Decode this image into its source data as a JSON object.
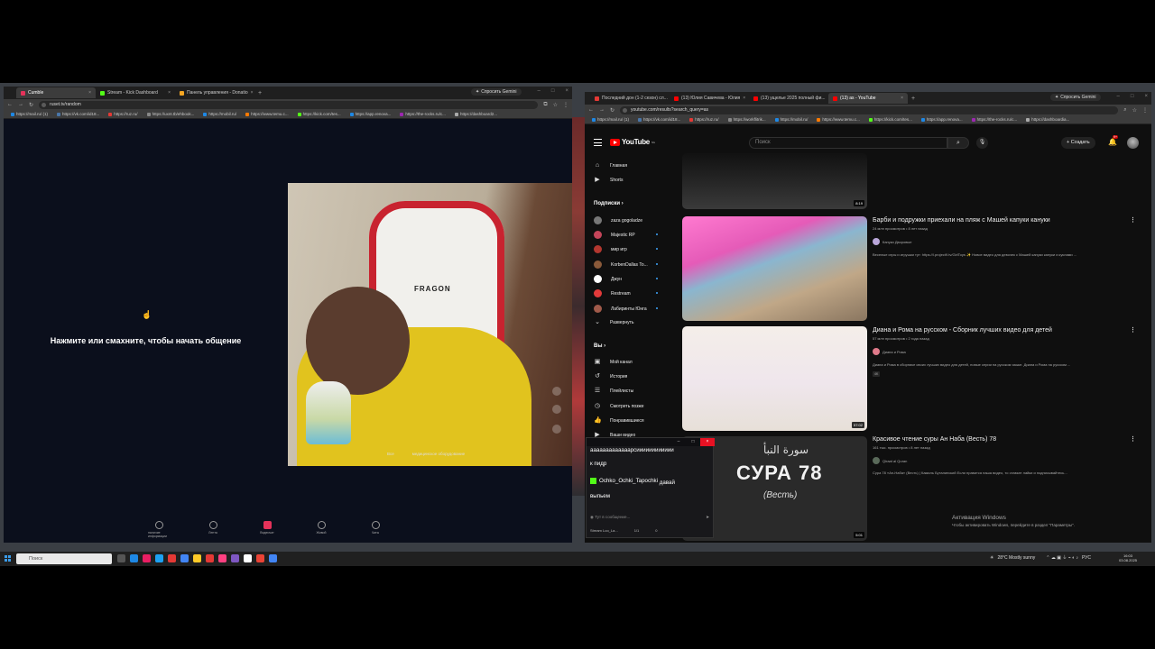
{
  "left_browser": {
    "tabs": [
      {
        "title": "Cumble",
        "color": "#e5325a",
        "active": true
      },
      {
        "title": "Stream - Kick Dashboard",
        "color": "#53fc18",
        "active": false
      },
      {
        "title": "Панель управления - Donatio",
        "color": "#f5a623",
        "active": false
      }
    ],
    "gemini_label": "Спросить Gemini",
    "url": "ruset.tv/random",
    "bookmarks": [
      "https://mail.ru/ (1)",
      "https://vk.com/id18...",
      "https://ruz.ru/",
      "https://uxnt.tb/ehbook...",
      "https://mobil.ru/",
      "https://www.temu.c...",
      "https://kick.com/tes...",
      "https://app.renova...",
      "https://the-rocks.ru/c...",
      "https://dashboard2..."
    ]
  },
  "left_app": {
    "prompt_text": "Нажмите или смахните, чтобы начать общение",
    "cam_label": "FRAGON",
    "overlay_left": "Все",
    "overlay_right": "медицинское оборудование",
    "nav": [
      {
        "label": "наличие информации",
        "active": false
      },
      {
        "label": "Лента",
        "active": false
      },
      {
        "label": "Видеочат",
        "active": true
      },
      {
        "label": "Живой",
        "active": false
      },
      {
        "label": "Чаты",
        "active": false
      }
    ]
  },
  "right_browser": {
    "tabs": [
      {
        "title": "Последний дон (1-2 сезон) сл...",
        "color": "#e53935",
        "active": false
      },
      {
        "title": "(13) Юлия Савичева - Юлия",
        "color": "#ff0000",
        "active": false
      },
      {
        "title": "(13) ущелье 2025 полный фи...",
        "color": "#ff0000",
        "active": false
      },
      {
        "title": "(13) as - YouTube",
        "color": "#ff0000",
        "active": true
      }
    ],
    "gemini_label": "Спросить Gemini",
    "url": "youtube.com/results?search_query=as",
    "bookmarks": [
      "https://mail.ru/ (1)",
      "https://vk.com/id18...",
      "https://ruz.ru/",
      "https://workflitrik...",
      "https://mobil.ru/",
      "https://www.temu.c...",
      "https://kick.com/tes...",
      "https://app.renova...",
      "https://the-rocks.ru/c...",
      "https://dashboardia..."
    ]
  },
  "youtube": {
    "logo": "YouTube",
    "logo_region": "NG",
    "search_placeholder": "Поиск",
    "create_label": "Создать",
    "notif_count": "9+",
    "sidebar": {
      "main": [
        "Главная",
        "Shorts"
      ],
      "subs_header": "Подписки",
      "subs": [
        {
          "name": "zaza gogoladze",
          "color": "#777777",
          "dot": false
        },
        {
          "name": "Majestic RP",
          "color": "#c4455a",
          "dot": true
        },
        {
          "name": "мир игр",
          "color": "#b3372f",
          "dot": true
        },
        {
          "name": "KorbenDallas To...",
          "color": "#8a5a3a",
          "dot": true
        },
        {
          "name": "Джун",
          "color": "#ffffff",
          "dot": true
        },
        {
          "name": "Restream",
          "color": "#e23a3a",
          "dot": true
        },
        {
          "name": "Лабиринты Юнга",
          "color": "#a05a4a",
          "dot": true
        }
      ],
      "expand": "Развернуть",
      "you_header": "Вы",
      "you": [
        "Мой канал",
        "История",
        "Плейлисты",
        "Смотреть позже",
        "Понравившиеся",
        "Ваши видео"
      ]
    },
    "videos": [
      {
        "duration": "8:19"
      },
      {
        "title": "Барби и подружки приехали на пляж с Машей капуки кануки",
        "meta": "24 млн просмотров • 8 лет назад",
        "channel": "Капуки Дворовые",
        "desc": "Веселые игры и игрушки тут: https://l.project9.tv/GirlToys ✨ Новое видео для девочек с Машей капуки кануки и куклами ..."
      },
      {
        "title": "Диана и Рома на русском - Сборник лучших видео для детей",
        "meta": "57 млн просмотров • 2 года назад",
        "channel": "Диана и Рома",
        "desc": "Диана и Рома в сборнике своих лучших видео для детей, новые серии на русском языке. Диана и Рома на русском ...",
        "badge": "4K",
        "duration": "57:02"
      },
      {
        "title": "Красивое чтение суры Ан Наба (Весть) 78",
        "meta": "161 тыс. просмотров • 8 лет назад",
        "channel": "Qiraat al Quran",
        "desc": "Сура 78 «Ан-Наба» (Весть) | Камаль Буталинский Если нравится наша видео, то ставьте лайки и подписывайтесь...",
        "thumb_arabic": "سورة النبأ",
        "thumb_text": "СУРА 78",
        "thumb_sub": "(Весть)",
        "duration": "5:01"
      }
    ],
    "activation_title": "Активация Windows",
    "activation_sub": "Чтобы активировать Windows, перейдите в раздел \"Параметры\"."
  },
  "chat_popup": {
    "line1": "ааааааааааааарсииииииииииии",
    "line2": "к пидр",
    "username": "Ochko_Ochki_Tapochki",
    "line3_rest": "давай",
    "line4": "выпьем",
    "input_placeholder": "Тут в сообщение...",
    "footer_left": "Stream Loo_La...",
    "footer_mid": "1/1",
    "footer_right": "0"
  },
  "taskbar": {
    "search_placeholder": "Поиск",
    "weather": "28°C  Mostly sunny",
    "lang": "РУС",
    "time": "16:03",
    "date": "03.08.2025",
    "apps_colors": [
      "#555",
      "#1e88e5",
      "#e91e63",
      "#1da1f2",
      "#e53935",
      "#4285f4",
      "#ffca28",
      "#e53935",
      "#ff4081",
      "#7e57c2",
      "#ffffff",
      "#ea4335",
      "#4285f4"
    ]
  }
}
